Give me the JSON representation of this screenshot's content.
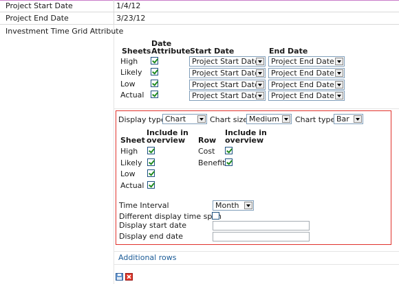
{
  "project": {
    "start_label": "Project Start Date",
    "start_value": "1/4/12",
    "end_label": "Project End Date",
    "end_value": "3/23/12",
    "grid_label": "Investment Time Grid Attribute"
  },
  "grid": {
    "headers": {
      "sheets": "Sheets",
      "date_attr_line1": "Date",
      "date_attr_line2": "Attribute",
      "start_date": "Start Date",
      "end_date": "End Date"
    },
    "rows": [
      {
        "sheet": "High",
        "checked": true,
        "start": "Project Start Date",
        "end": "Project End Date"
      },
      {
        "sheet": "Likely",
        "checked": true,
        "start": "Project Start Date",
        "end": "Project End Date"
      },
      {
        "sheet": "Low",
        "checked": true,
        "start": "Project Start Date",
        "end": "Project End Date"
      },
      {
        "sheet": "Actual",
        "checked": true,
        "start": "Project Start Date",
        "end": "Project End Date"
      }
    ]
  },
  "display": {
    "display_type_label": "Display type",
    "display_type_value": "Chart",
    "chart_size_label": "Chart size",
    "chart_size_value": "Medium",
    "chart_type_label": "Chart type",
    "chart_type_value": "Bar",
    "sheet_header": "Sheet",
    "include_line1": "Include in",
    "include_line2": "overview",
    "row_header": "Row",
    "sheets": [
      {
        "name": "High",
        "checked": true
      },
      {
        "name": "Likely",
        "checked": true
      },
      {
        "name": "Low",
        "checked": true
      },
      {
        "name": "Actual",
        "checked": true
      }
    ],
    "rows": [
      {
        "name": "Cost",
        "checked": true
      },
      {
        "name": "Benefit",
        "checked": true
      }
    ],
    "time_interval_label": "Time Interval",
    "time_interval_value": "Month",
    "different_span_label": "Different display time span",
    "different_span_checked": false,
    "display_start_label": "Display start date",
    "display_start_value": "",
    "display_end_label": "Display end date",
    "display_end_value": ""
  },
  "additional_rows_label": "Additional rows",
  "icons": {
    "save": "save-icon",
    "delete": "delete-icon"
  },
  "colors": {
    "highlight_border": "#e0302a",
    "link": "#1a5a96",
    "check": "#1f8a1f"
  }
}
